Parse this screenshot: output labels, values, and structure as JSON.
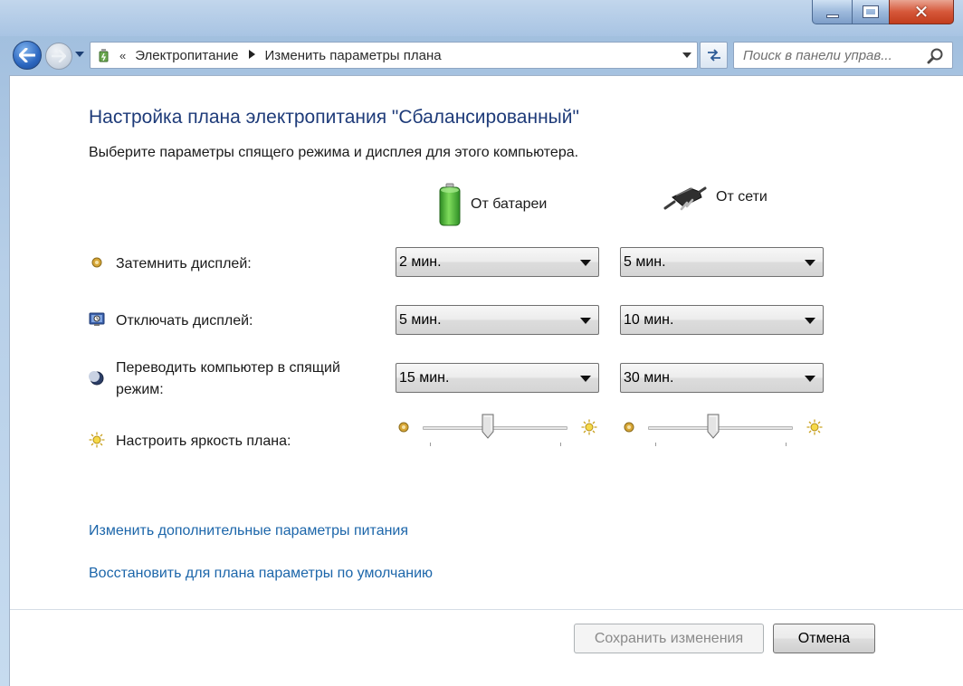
{
  "window": {
    "caption_close": "✕"
  },
  "address": {
    "chevron": "«",
    "crumbs": [
      "Электропитание",
      "Изменить параметры плана"
    ]
  },
  "search": {
    "placeholder": "Поиск в панели управ..."
  },
  "main": {
    "title": "Настройка плана электропитания \"Сбалансированный\"",
    "subtitle": "Выберите параметры спящего режима и дисплея для этого компьютера.",
    "columns": {
      "battery": "От батареи",
      "plugged": "От сети"
    },
    "rows": {
      "dim_display": {
        "label": "Затемнить дисплей:",
        "battery_value": "2 мин.",
        "plugged_value": "5 мин."
      },
      "turn_off_display": {
        "label": "Отключать дисплей:",
        "battery_value": "5 мин.",
        "plugged_value": "10 мин."
      },
      "sleep": {
        "label_line1": "Переводить компьютер в спящий",
        "label_line2": "режим:",
        "battery_value": "15 мин.",
        "plugged_value": "30 мин."
      },
      "brightness": {
        "label": "Настроить яркость плана:",
        "battery_level_percent": 45,
        "plugged_level_percent": 45
      }
    },
    "links": {
      "advanced": "Изменить дополнительные параметры питания",
      "restore": "Восстановить для плана параметры по умолчанию"
    },
    "buttons": {
      "save": "Сохранить изменения",
      "cancel": "Отмена"
    }
  },
  "colors": {
    "title": "#1e3b79",
    "link": "#1c66aa",
    "battery_green": "#3fb52f"
  },
  "icons": {
    "back": "arrow-left-icon",
    "forward": "arrow-right-icon",
    "refresh": "refresh-icon",
    "search": "search-icon",
    "battery": "battery-icon",
    "plug": "plug-icon",
    "dim": "dim-display-icon",
    "display_off": "display-off-icon",
    "sleep": "moon-icon",
    "brightness": "sun-icon"
  }
}
